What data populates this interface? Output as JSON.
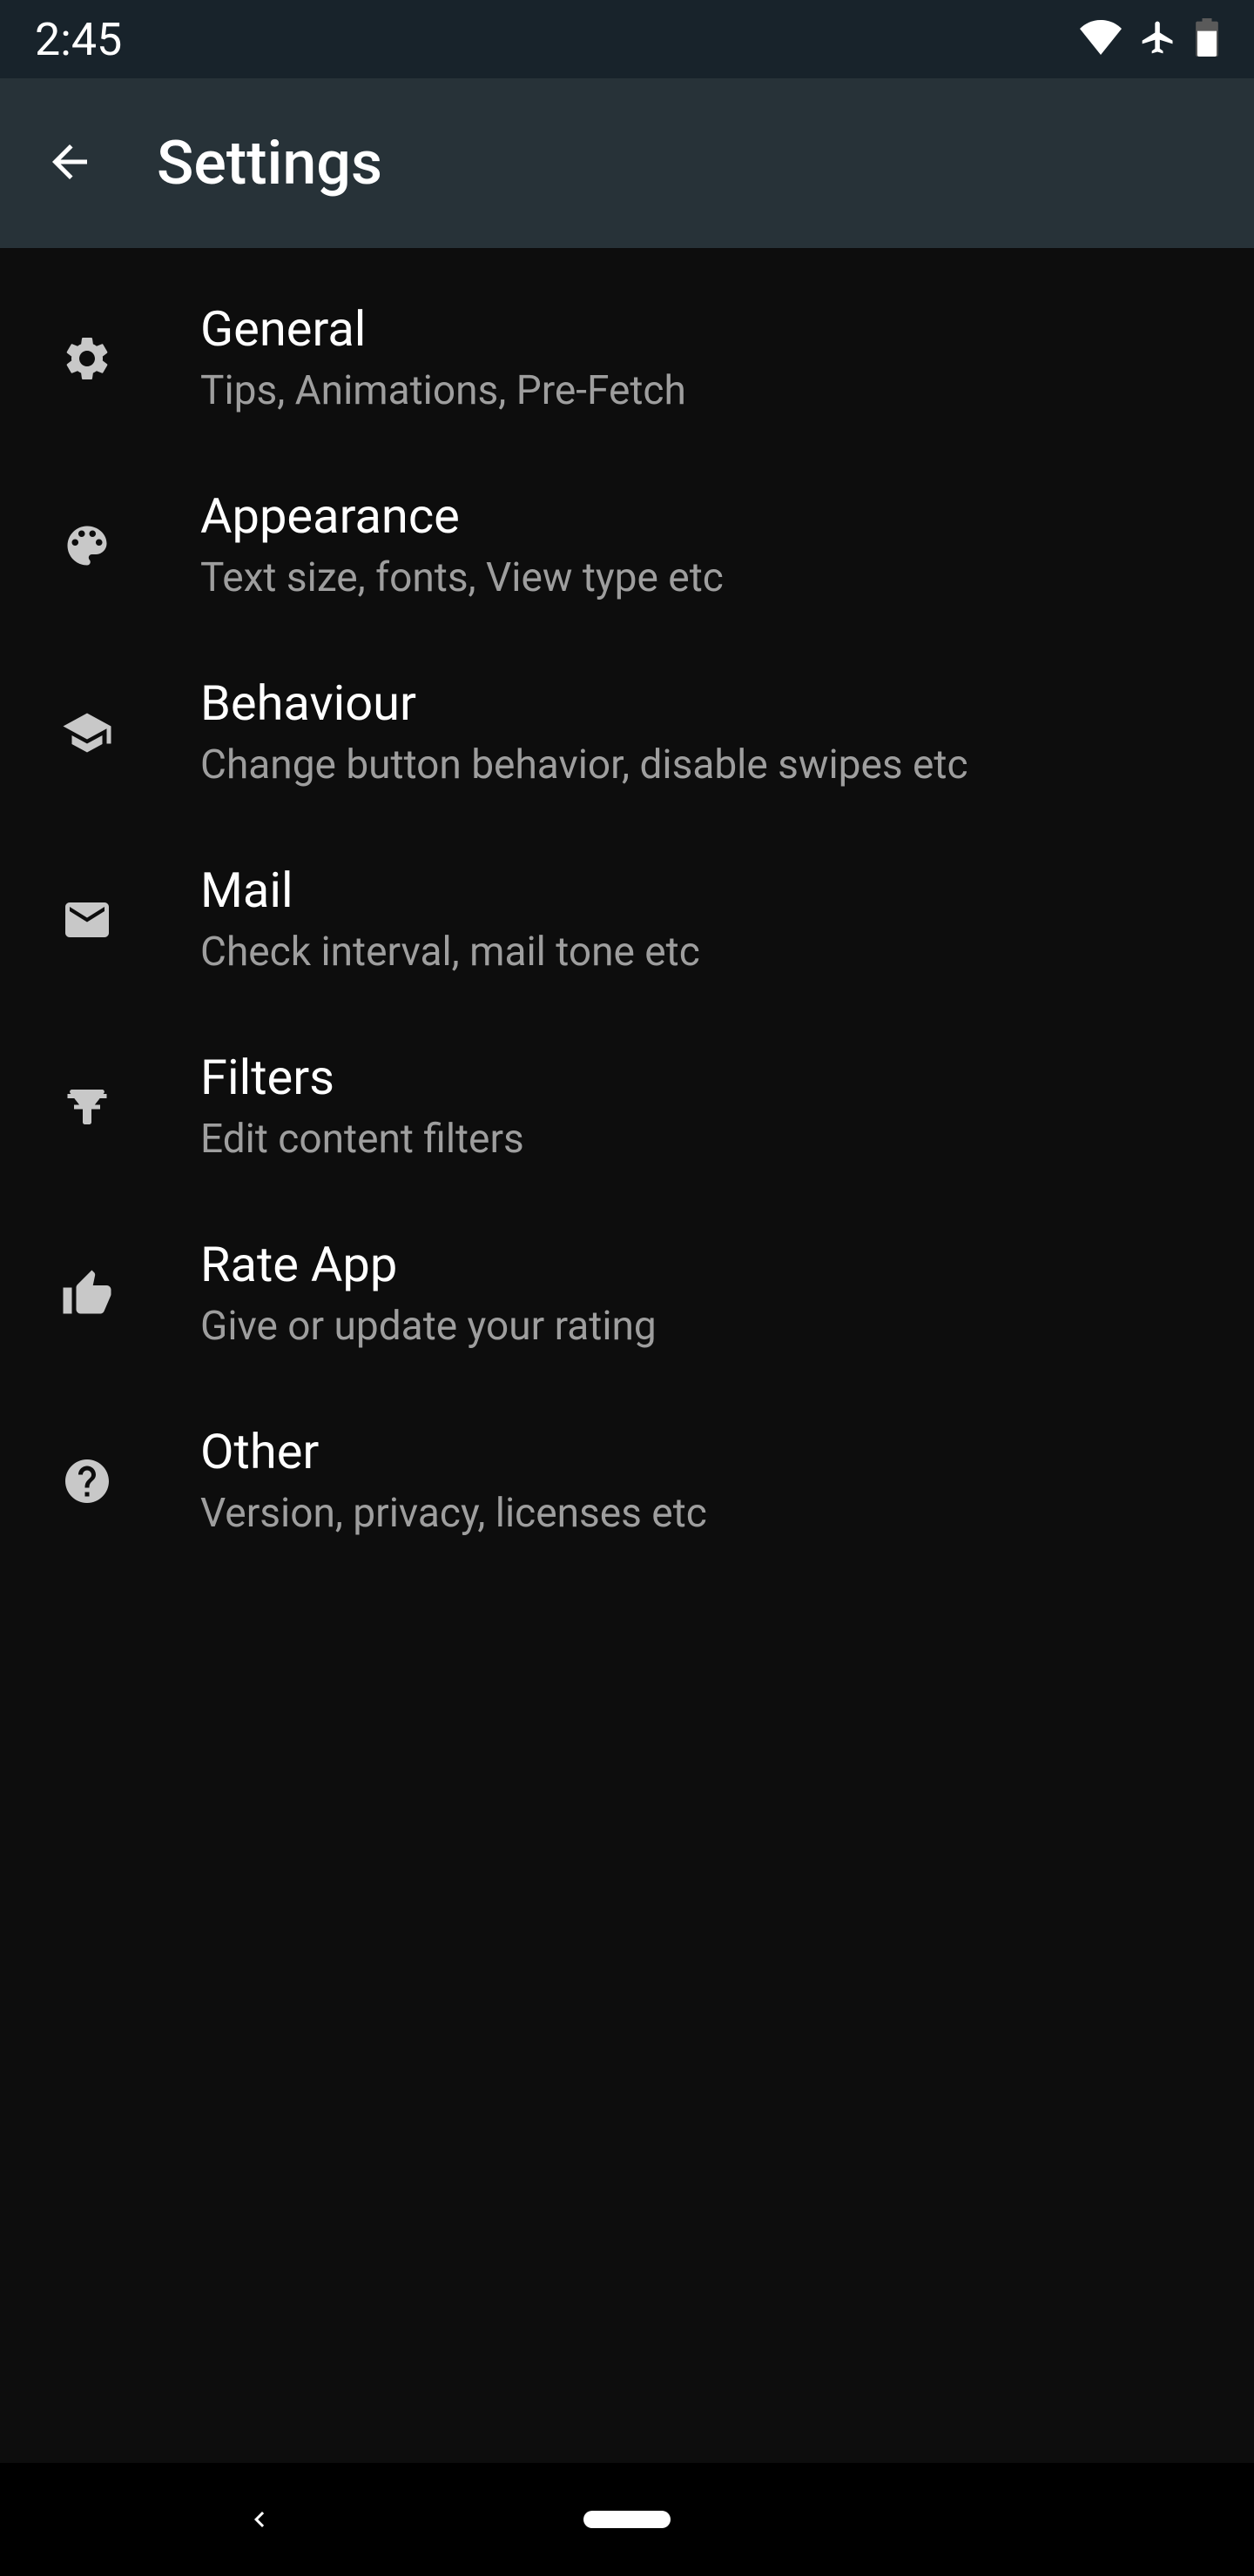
{
  "status": {
    "time": "2:45"
  },
  "appbar": {
    "title": "Settings"
  },
  "items": [
    {
      "title": "General",
      "subtitle": "Tips, Animations, Pre-Fetch",
      "icon": "gear-icon"
    },
    {
      "title": "Appearance",
      "subtitle": "Text size, fonts, View type etc",
      "icon": "palette-icon"
    },
    {
      "title": "Behaviour",
      "subtitle": "Change button behavior, disable swipes etc",
      "icon": "layers-icon"
    },
    {
      "title": "Mail",
      "subtitle": "Check interval, mail tone etc",
      "icon": "mail-icon"
    },
    {
      "title": "Filters",
      "subtitle": "Edit content filters",
      "icon": "filter-icon"
    },
    {
      "title": "Rate App",
      "subtitle": "Give or update your rating",
      "icon": "thumb-up-icon"
    },
    {
      "title": "Other",
      "subtitle": "Version, privacy, licenses etc",
      "icon": "help-icon"
    }
  ]
}
